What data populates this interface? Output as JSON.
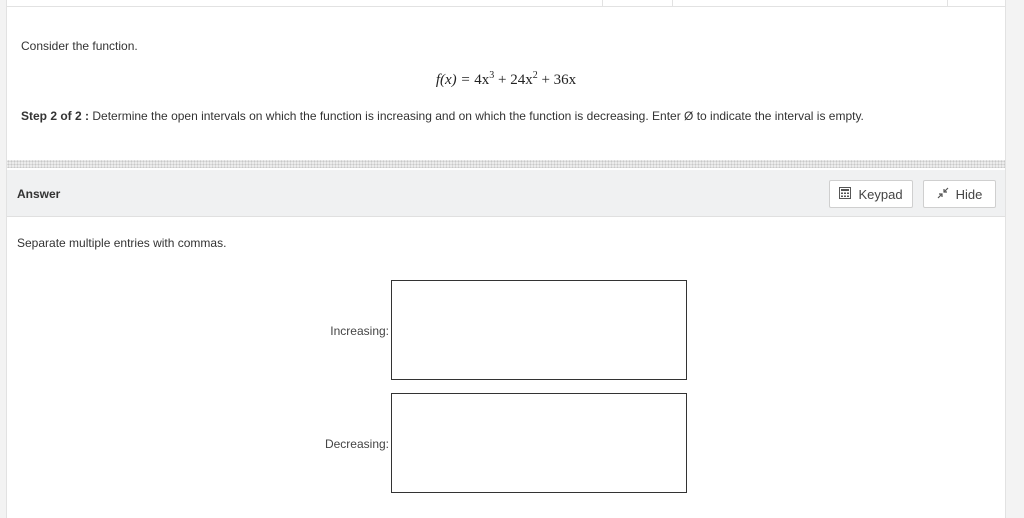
{
  "question": {
    "intro": "Consider the function.",
    "formula": {
      "lhs": "f(x) = ",
      "term1": "4x",
      "exp1": "3",
      "plus1": " + 24x",
      "exp2": "2",
      "rest": " + 36x"
    },
    "step_label": "Step 2 of 2 :",
    "step_text": "Determine the open intervals on which the function is increasing and on which the function is decreasing. Enter Ø to indicate the interval is empty."
  },
  "answer": {
    "title": "Answer",
    "keypad_label": "Keypad",
    "keypad_icon": "calculator-icon",
    "hide_label": "Hide",
    "hide_icon": "collapse-arrows-icon",
    "hint": "Separate multiple entries with commas.",
    "fields": [
      {
        "label": "Increasing:",
        "value": ""
      },
      {
        "label": "Decreasing:",
        "value": ""
      }
    ]
  }
}
